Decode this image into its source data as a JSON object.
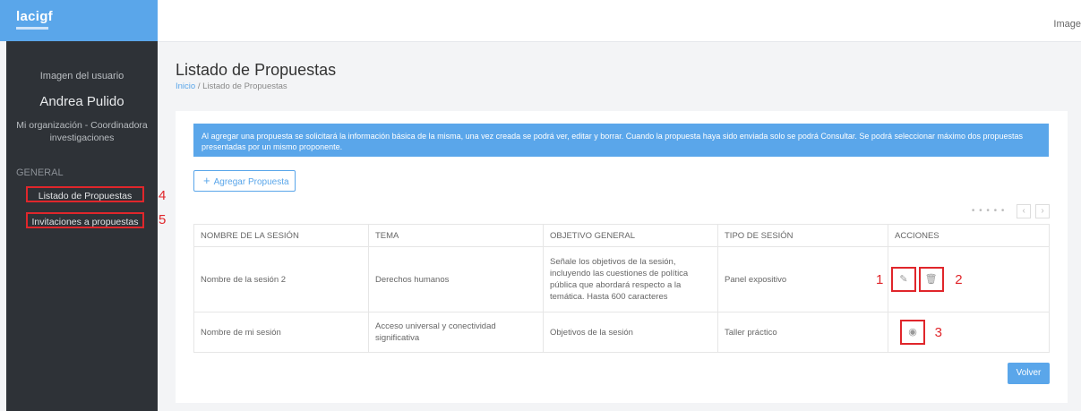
{
  "logo": {
    "text": "lacigf"
  },
  "topbar": {
    "image_text": "Image"
  },
  "sidebar": {
    "user_image": "Imagen del usuario",
    "user_name": "Andrea Pulido",
    "user_org": "Mi organización - Coordinadora investigaciones",
    "section": "GENERAL",
    "items": [
      {
        "label": "Listado de Propuestas"
      },
      {
        "label": "Invitaciones a propuestas"
      }
    ]
  },
  "annotations": {
    "a1": "1",
    "a2": "2",
    "a3": "3",
    "a4": "4",
    "a5": "5"
  },
  "header": {
    "title": "Listado de Propuestas",
    "breadcrumb": {
      "home": "Inicio",
      "sep": "/",
      "current": "Listado de Propuestas"
    }
  },
  "info": "Al agregar una propuesta se solicitará la información básica de la misma, una vez creada se podrá ver, editar y borrar. Cuando la propuesta haya sido enviada solo se podrá Consultar. Se podrá seleccionar máximo dos propuestas presentadas por un mismo proponente.",
  "add_button": {
    "icon": "+",
    "label": "Agregar Propuesta"
  },
  "pager": {
    "dots": "• • • • •",
    "prev": "‹",
    "next": "›"
  },
  "table": {
    "headers": [
      "NOMBRE DE LA SESIÓN",
      "TEMA",
      "OBJETIVO GENERAL",
      "TIPO DE SESIÓN",
      "ACCIONES"
    ],
    "rows": [
      {
        "nombre": "Nombre de la sesión 2",
        "tema": "Derechos humanos",
        "objetivo": "Señale los objetivos de la sesión, incluyendo las cuestiones de política pública que abordará respecto a la temática. Hasta 600 caracteres",
        "tipo": "Panel expositivo"
      },
      {
        "nombre": "Nombre de mi sesión",
        "tema": "Acceso universal y conectividad significativa",
        "objetivo": "Objetivos de la sesión",
        "tipo": "Taller práctico"
      }
    ]
  },
  "icons": {
    "edit": "✎",
    "delete": "🗑",
    "view": "◉"
  },
  "colors": {
    "accent": "#5aa6ea",
    "sidebar": "#2e3237",
    "annotation": "#e0262b"
  },
  "back_button": "Volver"
}
